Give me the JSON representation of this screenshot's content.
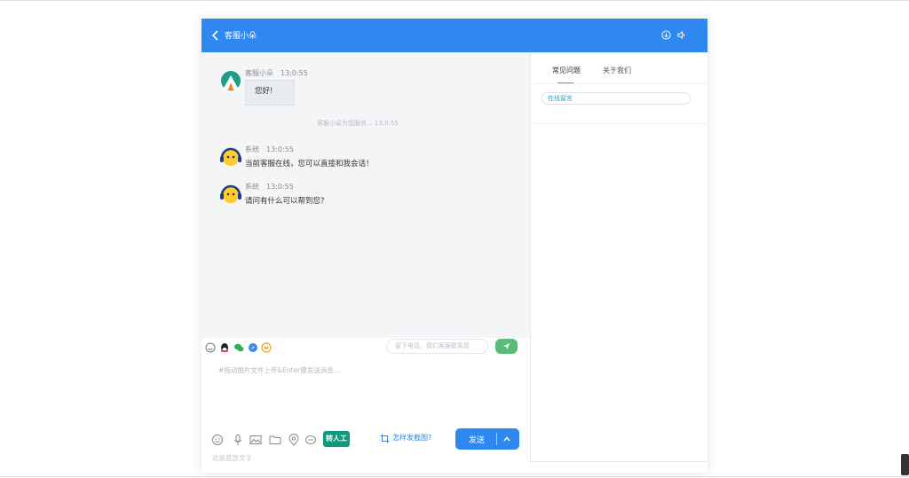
{
  "header": {
    "title": "客服小朵"
  },
  "messages": [
    {
      "sender": "客服小朵",
      "time": "13:0:55",
      "text": "您好!"
    },
    {
      "sender": "系统",
      "time": "13:0:55",
      "text": "当前客服在线，您可以直接和我会话！"
    },
    {
      "sender": "系统",
      "time": "13:0:55",
      "text": "请问有什么可以帮到您?"
    }
  ],
  "system_note": "客服小朵为您服务... 13:0:55",
  "toolbar": {
    "phone_placeholder": "留下电话，我们客服联系您"
  },
  "input": {
    "placeholder": "#拖动图片文件上传&Enter键发送消息..."
  },
  "bottom": {
    "transfer_label": "转人工",
    "screenshot_label": "怎样发截图?",
    "send_label": "发送"
  },
  "footer": {
    "text": "这是底部文字"
  },
  "side": {
    "tabs": [
      "常见问题",
      "关于我们"
    ],
    "leave_message": "在线留言"
  },
  "colors": {
    "header": "#2f88f0",
    "accent": "#11997e",
    "send_small": "#5bbb78"
  },
  "icons": {
    "back": "chevron-left-icon",
    "download": "download-icon",
    "sound": "speaker-icon"
  }
}
